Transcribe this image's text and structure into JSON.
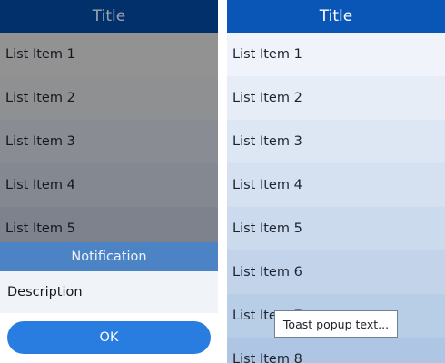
{
  "left_screen": {
    "title": "Title",
    "list_items": [
      "List Item 1",
      "List Item 2",
      "List Item 3",
      "List Item 4",
      "List Item 5"
    ],
    "popup": {
      "title": "Notification",
      "description": "Description",
      "ok_label": "OK"
    }
  },
  "right_screen": {
    "title": "Title",
    "list_items": [
      "List Item 1",
      "List Item 2",
      "List Item 3",
      "List Item 4",
      "List Item 5",
      "List Item 6",
      "List Item 7",
      "List Item 8"
    ],
    "toast": "Toast popup text..."
  },
  "colors": {
    "title_bar_dim": "#02306b",
    "title_bar": "#0a56b7",
    "popup_title": "#4c83c5",
    "ok_button": "#2a7de0"
  }
}
